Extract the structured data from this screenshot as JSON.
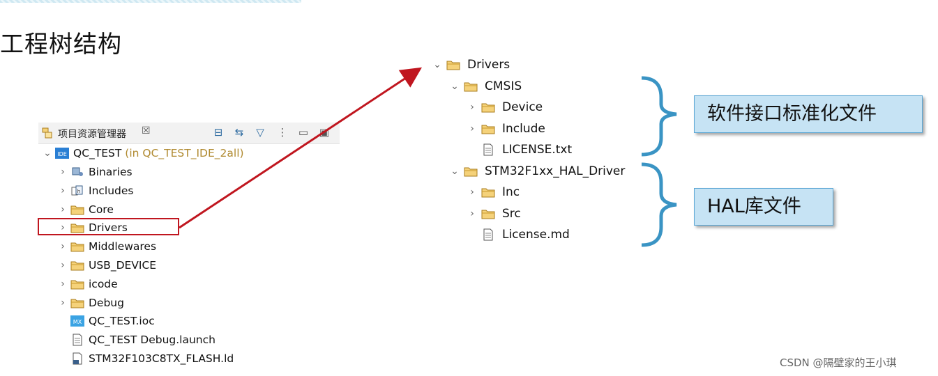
{
  "heading": "工程树结构",
  "explorer": {
    "title": "项目资源管理器",
    "close_glyph": "☒",
    "toolbar": [
      "collapse-all",
      "link-editor",
      "filter",
      "view-menu",
      "minimize",
      "maximize"
    ],
    "project": {
      "name": "QC_TEST",
      "suffix": "(in QC_TEST_IDE_2all)"
    },
    "items": [
      {
        "label": "Binaries",
        "icon": "binaries-icon",
        "chevron": ">"
      },
      {
        "label": "Includes",
        "icon": "includes-icon",
        "chevron": ">"
      },
      {
        "label": "Core",
        "icon": "folder-icon",
        "chevron": ">"
      },
      {
        "label": "Drivers",
        "icon": "folder-icon",
        "chevron": ">"
      },
      {
        "label": "Middlewares",
        "icon": "folder-icon",
        "chevron": ">"
      },
      {
        "label": "USB_DEVICE",
        "icon": "folder-icon",
        "chevron": ">"
      },
      {
        "label": "icode",
        "icon": "folder-icon",
        "chevron": ">"
      },
      {
        "label": "Debug",
        "icon": "folder-icon",
        "chevron": ">"
      },
      {
        "label": "QC_TEST.ioc",
        "icon": "mx-file-icon",
        "chevron": ""
      },
      {
        "label": "QC_TEST Debug.launch",
        "icon": "file-icon",
        "chevron": ""
      },
      {
        "label": "STM32F103C8TX_FLASH.ld",
        "icon": "ld-file-icon",
        "chevron": ""
      }
    ]
  },
  "detail_tree": [
    {
      "label": "Drivers",
      "chevron": "v",
      "indent": 0
    },
    {
      "label": "CMSIS",
      "chevron": "v",
      "indent": 1
    },
    {
      "label": "Device",
      "chevron": ">",
      "indent": 2
    },
    {
      "label": "Include",
      "chevron": ">",
      "indent": 2
    },
    {
      "label": "LICENSE.txt",
      "chevron": "",
      "indent": 2
    },
    {
      "label": "STM32F1xx_HAL_Driver",
      "chevron": "v",
      "indent": 1
    },
    {
      "label": "Inc",
      "chevron": ">",
      "indent": 2
    },
    {
      "label": "Src",
      "chevron": ">",
      "indent": 2
    },
    {
      "label": "License.md",
      "chevron": "",
      "indent": 2
    }
  ],
  "callouts": {
    "cmsis": "软件接口标准化文件",
    "hal": "HAL库文件"
  },
  "watermark": "CSDN @隔壁家的王小琪",
  "colors": {
    "highlight": "#c0161f",
    "callout_bg": "#c6e3f4",
    "brace": "#3a94c4",
    "folder": "#f0c860"
  }
}
